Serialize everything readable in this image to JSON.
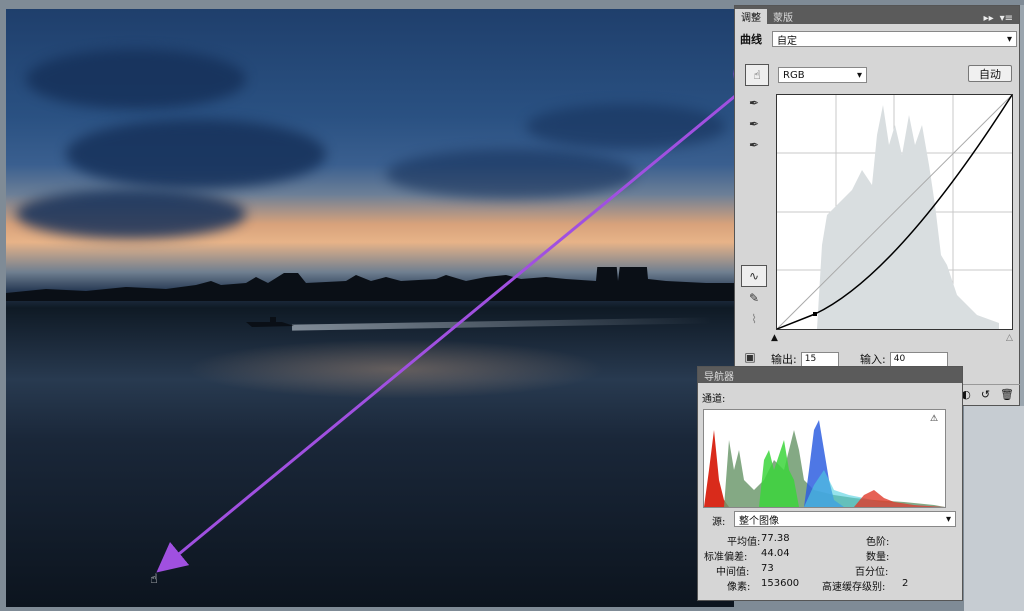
{
  "adjustments_panel": {
    "tabs": [
      "调整",
      "蒙版"
    ],
    "curves_label": "曲线",
    "preset_value": "自定",
    "channel_value": "RGB",
    "auto_button": "自动",
    "output_label": "输出:",
    "output_value": "15",
    "input_label": "输入:",
    "input_value": "40"
  },
  "histogram_panel": {
    "tab_label": "导航器",
    "channel_label": "通道:",
    "source_label": "源:",
    "source_value": "整个图像",
    "stats": {
      "mean_label": "平均值:",
      "mean_value": "77.38",
      "stddev_label": "标准偏差:",
      "stddev_value": "44.04",
      "median_label": "中间值:",
      "median_value": "73",
      "pixels_label": "像素:",
      "pixels_value": "153600",
      "level_label": "色阶:",
      "count_label": "数量:",
      "percentile_label": "百分位:",
      "cache_label": "高速缓存级别:",
      "cache_value": "2"
    }
  },
  "colors": {
    "annotation_purple": "#a050e0",
    "panel_bg": "#d6d6d6"
  }
}
